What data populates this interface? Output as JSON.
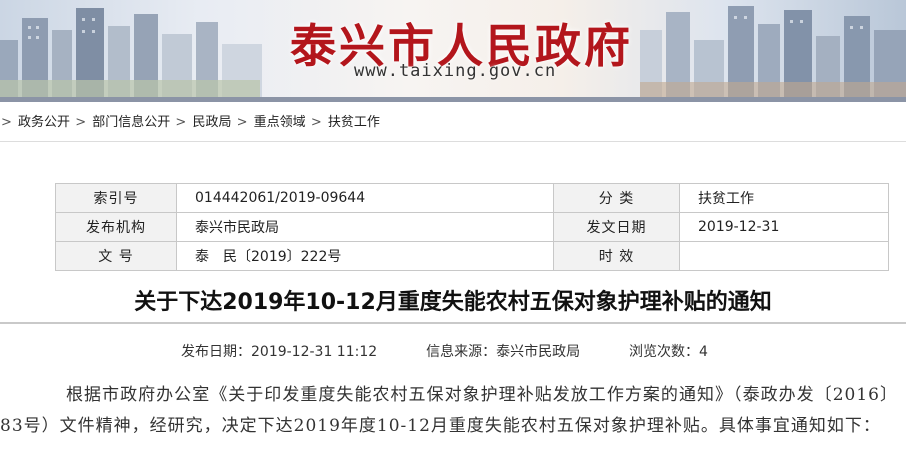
{
  "banner": {
    "site_title": "泰兴市人民政府",
    "site_url": "www.taixing.gov.cn",
    "title_color": "#b3161c"
  },
  "breadcrumb": {
    "separator": ">",
    "items": [
      "政务公开",
      "部门信息公开",
      "民政局",
      "重点领域",
      "扶贫工作"
    ]
  },
  "info": {
    "index_label": "索引号",
    "index_value": "014442061/2019-09644",
    "category_label": "分 类",
    "category_value": "扶贫工作",
    "issuer_label": "发布机构",
    "issuer_value": "泰兴市民政局",
    "issue_date_label": "发文日期",
    "issue_date_value": "2019-12-31",
    "doc_no_label": "文 号",
    "doc_no_value": "泰　民〔2019〕222号",
    "validity_label": "时 效",
    "validity_value": ""
  },
  "article": {
    "title": "关于下达2019年10-12月重度失能农村五保对象护理补贴的通知",
    "publish_label": "发布日期：",
    "publish_value": "2019-12-31 11:12",
    "source_label": "信息来源：",
    "source_value": "泰兴市民政局",
    "views_label": "浏览次数：",
    "views_value": "4",
    "paragraph": "根据市政府办公室《关于印发重度失能农村五保对象护理补贴发放工作方案的通知》（泰政办发〔2016〕83号）文件精神，经研究，决定下达2019年度10-12月重度失能农村五保对象护理补贴。具体事宜通知如下："
  }
}
